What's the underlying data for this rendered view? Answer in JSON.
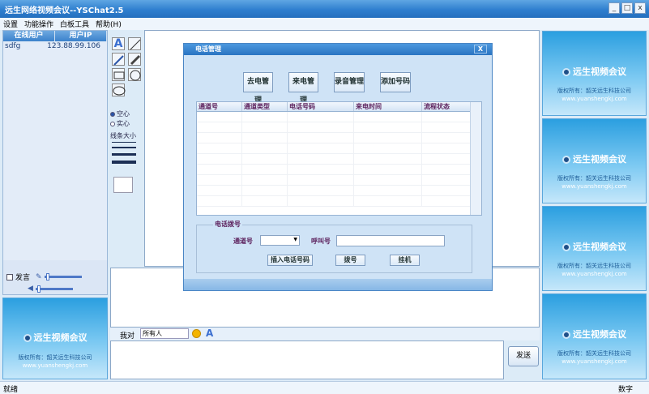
{
  "window": {
    "title": "远生网络视频会议--YSChat2.5",
    "controls": [
      "_",
      "□",
      "x"
    ]
  },
  "menu": [
    "设置",
    "功能操作",
    "白板工具",
    "帮助(H)"
  ],
  "user_list": {
    "headers": [
      "在线用户",
      "用户IP"
    ],
    "rows": [
      {
        "name": "sdfg",
        "ip": "123.88.99.106"
      }
    ]
  },
  "audio": {
    "speak_label": "发言"
  },
  "whiteboard_tools": {
    "modes": [
      {
        "label": "空心",
        "selected": true
      },
      {
        "label": "实心",
        "selected": false
      }
    ],
    "line_size_label": "线条大小"
  },
  "logo_tile": {
    "brand": "远生视频会议",
    "copyright": "版权所有：韶关远生科技公司",
    "url": "www.yuanshengkj.com"
  },
  "chat": {
    "to_label": "我对",
    "recipient": "所有人",
    "send_label": "发送"
  },
  "status": {
    "left": "就绪",
    "right": "数字"
  },
  "dialog": {
    "title": "电话管理",
    "close": "X",
    "top_buttons": [
      "去电管理",
      "来电管理",
      "录音管理",
      "添加号码"
    ],
    "columns": [
      "通道号",
      "通道类型",
      "电话号码",
      "来电时间",
      "流程状态"
    ],
    "group_title": "电话拨号",
    "channel_label": "通道号",
    "call_label": "呼叫号",
    "actions": [
      "插入电话号码",
      "拨号",
      "挂机"
    ]
  }
}
